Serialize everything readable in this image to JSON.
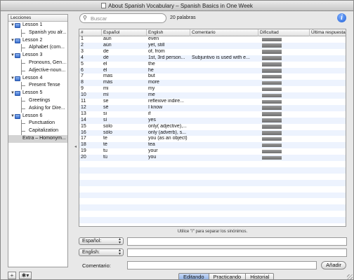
{
  "window": {
    "title": "About Spanish Vocabulary – Spanish Basics in One Week"
  },
  "sidebar": {
    "header": "Lecciones",
    "tree": [
      {
        "kind": "group",
        "label": "Lesson 1"
      },
      {
        "kind": "item",
        "label": "Spanish you alr..."
      },
      {
        "kind": "group",
        "label": "Lesson 2"
      },
      {
        "kind": "item",
        "label": "Alphabet (com..."
      },
      {
        "kind": "group",
        "label": "Lesson 3"
      },
      {
        "kind": "item",
        "label": "Pronouns, Gend..."
      },
      {
        "kind": "item",
        "label": "Adjective-noun..."
      },
      {
        "kind": "group",
        "label": "Lesson 4"
      },
      {
        "kind": "item",
        "label": "Present Tense"
      },
      {
        "kind": "group",
        "label": "Lesson 5"
      },
      {
        "kind": "item",
        "label": "Greetings"
      },
      {
        "kind": "item",
        "label": "Asking for Dire..."
      },
      {
        "kind": "group",
        "label": "Lesson 6"
      },
      {
        "kind": "item",
        "label": "Punctuation"
      },
      {
        "kind": "item",
        "label": "Capitalization"
      },
      {
        "kind": "solo",
        "label": "Extra – Homonym...",
        "selected": true
      }
    ],
    "add_label": "+",
    "action_label": "✱▾"
  },
  "toolbar": {
    "search_placeholder": "Buscar",
    "word_count": "20 palabras"
  },
  "table": {
    "columns": [
      "#",
      "Español",
      "English",
      "Comentario",
      "Dificultad",
      "Última respuesta"
    ],
    "rows": [
      {
        "n": "1",
        "es": "aun",
        "en": "even",
        "c": "",
        "d": 1
      },
      {
        "n": "2",
        "es": "aún",
        "en": "yet, still",
        "c": "",
        "d": 1
      },
      {
        "n": "3",
        "es": "de",
        "en": "of, from",
        "c": "",
        "d": 1
      },
      {
        "n": "4",
        "es": "dé",
        "en": "1st, 3rd person...",
        "c": "Subjuntivo is used with e...",
        "d": 1
      },
      {
        "n": "5",
        "es": "el",
        "en": "the",
        "c": "",
        "d": 1
      },
      {
        "n": "6",
        "es": "él",
        "en": "he",
        "c": "",
        "d": 1
      },
      {
        "n": "7",
        "es": "mas",
        "en": "but",
        "c": "",
        "d": 1
      },
      {
        "n": "8",
        "es": "más",
        "en": "more",
        "c": "",
        "d": 1
      },
      {
        "n": "9",
        "es": "mi",
        "en": "my",
        "c": "",
        "d": 1
      },
      {
        "n": "10",
        "es": "mí",
        "en": "me",
        "c": "",
        "d": 1
      },
      {
        "n": "11",
        "es": "se",
        "en": "reflexive indire...",
        "c": "",
        "d": 1
      },
      {
        "n": "12",
        "es": "sé",
        "en": "I know",
        "c": "",
        "d": 1
      },
      {
        "n": "13",
        "es": "si",
        "en": "if",
        "c": "",
        "d": 1
      },
      {
        "n": "14",
        "es": "sí",
        "en": "yes",
        "c": "",
        "d": 1
      },
      {
        "n": "15",
        "es": "solo",
        "en": "only( adjective),...",
        "c": "",
        "d": 1
      },
      {
        "n": "16",
        "es": "sólo",
        "en": "only (adverb), s...",
        "c": "",
        "d": 1
      },
      {
        "n": "17",
        "es": "te",
        "en": "you (as an object)",
        "c": "",
        "d": 1
      },
      {
        "n": "18",
        "es": "té",
        "en": "tea",
        "c": "",
        "d": 1
      },
      {
        "n": "19",
        "es": "tu",
        "en": "your",
        "c": "",
        "d": 1
      },
      {
        "n": "20",
        "es": "tú",
        "en": "you",
        "c": "",
        "d": 1
      }
    ]
  },
  "hint": "Utilice \"/\" para separar los sinónimos.",
  "form": {
    "spanish_label": "Español:",
    "english_label": "English:",
    "comment_label": "Comentario:",
    "spanish_value": "",
    "english_value": "",
    "comment_value": "",
    "add_label": "Añadir"
  },
  "tabs": [
    {
      "label": "Editando",
      "active": true
    },
    {
      "label": "Practicando",
      "active": false
    },
    {
      "label": "Historial",
      "active": false
    }
  ]
}
